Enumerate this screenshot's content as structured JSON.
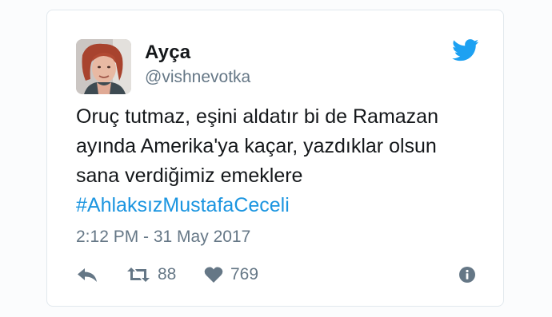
{
  "tweet": {
    "author_name": "Ayça",
    "author_handle": "@vishnevotka",
    "text_lines": [
      "Oruç tutmaz, eşini aldatır bi de Ramazan",
      "ayında Amerika'ya kaçar, yazdıklar olsun",
      "sana verdiğimiz emeklere"
    ],
    "hashtag": "#AhlaksızMustafaCeceli",
    "timestamp": "2:12 PM - 31 May 2017",
    "retweet_count": "88",
    "like_count": "769"
  },
  "icons": {
    "brand": "twitter-bird-icon",
    "reply": "reply-icon",
    "retweet": "retweet-icon",
    "like": "heart-icon",
    "info": "info-icon"
  },
  "colors": {
    "brand_blue": "#1da1f2",
    "hashtag_blue": "#1b95e0",
    "secondary_text": "#657786",
    "primary_text": "#14171a",
    "border": "#e1e8ed"
  }
}
